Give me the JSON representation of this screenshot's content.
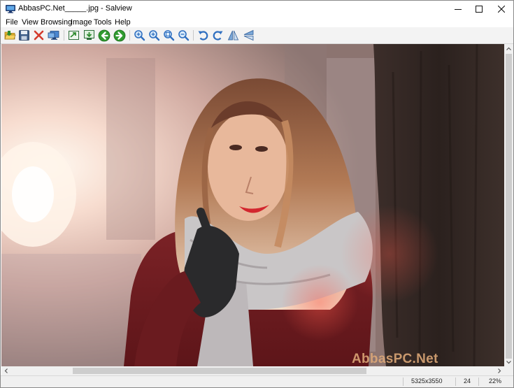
{
  "window": {
    "title": "AbbasPC.Net_____.jpg - Salview",
    "icon": "monitor-icon",
    "controls": [
      "minimize-icon",
      "maximize-icon",
      "close-icon"
    ]
  },
  "menu": [
    "File",
    "View",
    "Browsing",
    "Image",
    "Tools",
    "Help"
  ],
  "toolbar": {
    "buttons": [
      "open-folder-icon",
      "save-icon",
      "delete-icon",
      "slideshow-icon",
      "export-icon",
      "set-wallpaper-icon",
      "previous-icon",
      "next-icon",
      "zoom-in-icon",
      "zoom-in-alt-icon",
      "zoom-fit-icon",
      "zoom-out-icon",
      "rotate-left-icon",
      "rotate-right-icon",
      "flip-vertical-icon",
      "flip-horizontal-icon"
    ]
  },
  "image": {
    "description_icon": "photo-woman-scarf",
    "watermark": "AbbasPC.Net"
  },
  "status": {
    "dimensions": "5325x3550",
    "bit_depth": "24",
    "zoom": "22%"
  },
  "colors": {
    "toolbar_bg": "#f3f3f3",
    "scrollbar_bg": "#f0f0f0",
    "scroll_thumb": "#cdcdcd",
    "accent_green": "#2e8b2e"
  }
}
